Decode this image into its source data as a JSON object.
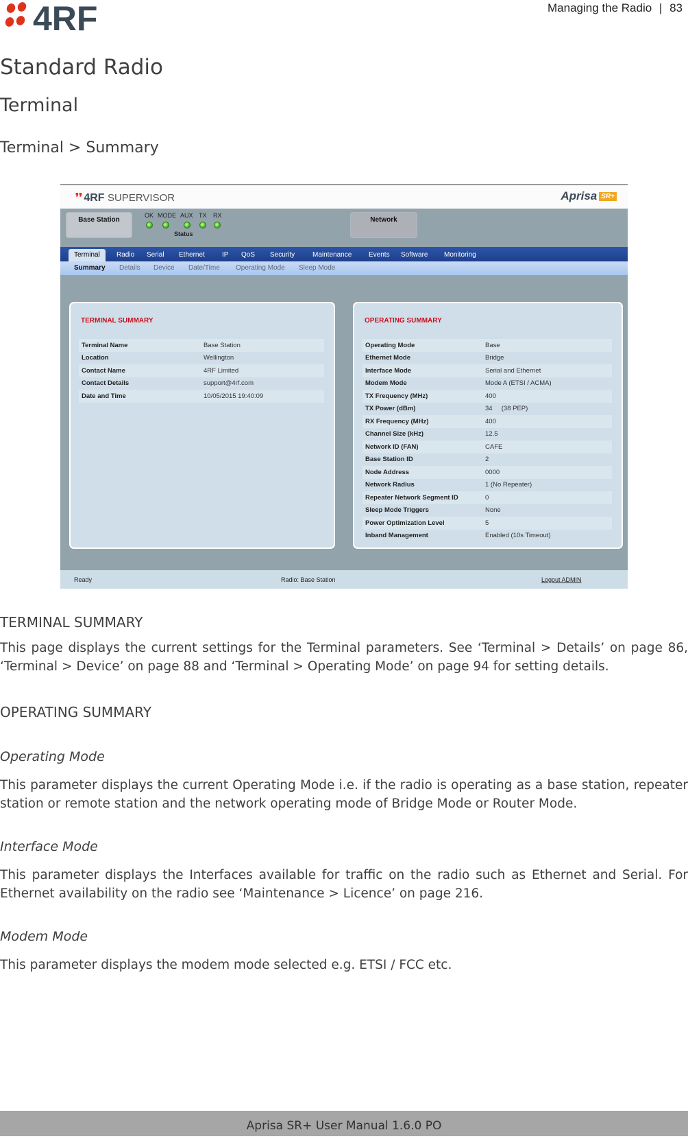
{
  "page_header": {
    "logo_text": "4RF",
    "section": "Managing the Radio",
    "separator": "|",
    "page_number": "83"
  },
  "headings": {
    "h1": "Standard Radio",
    "h2": "Terminal",
    "h3": "Terminal > Summary"
  },
  "screenshot": {
    "brand": {
      "dots": "❜❜",
      "name": "4RF",
      "product": "SUPERVISOR"
    },
    "aprisa": {
      "name": "Aprisa",
      "badge": "SR+"
    },
    "base_station_label": "Base Station",
    "network_label": "Network",
    "leds": [
      {
        "label": "OK",
        "color": "#35b015"
      },
      {
        "label": "MODE",
        "color": "#35b015"
      },
      {
        "label": "AUX",
        "color": "#35b015"
      },
      {
        "label": "TX",
        "color": "#35b015"
      },
      {
        "label": "RX",
        "color": "#35b015"
      }
    ],
    "status_label": "Status",
    "tabs": [
      "Terminal",
      "Radio",
      "Serial",
      "Ethernet",
      "IP",
      "QoS",
      "Security",
      "Maintenance",
      "Events",
      "Software",
      "Monitoring"
    ],
    "active_tab": "Terminal",
    "subtabs": [
      "Summary",
      "Details",
      "Device",
      "Date/Time",
      "Operating Mode",
      "Sleep Mode"
    ],
    "active_subtab": "Summary",
    "terminal_summary": {
      "title": "TERMINAL SUMMARY",
      "rows": [
        {
          "key": "Terminal Name",
          "value": "Base Station"
        },
        {
          "key": "Location",
          "value": "Wellington"
        },
        {
          "key": "Contact Name",
          "value": "4RF Limited"
        },
        {
          "key": "Contact Details",
          "value": "support@4rf.com"
        },
        {
          "key": "Date and Time",
          "value": "10/05/2015 19:40:09"
        }
      ]
    },
    "operating_summary": {
      "title": "OPERATING SUMMARY",
      "rows": [
        {
          "key": "Operating Mode",
          "value": "Base"
        },
        {
          "key": "Ethernet Mode",
          "value": "Bridge"
        },
        {
          "key": "Interface Mode",
          "value": "Serial and Ethernet"
        },
        {
          "key": "Modem Mode",
          "value": "Mode A (ETSI / ACMA)"
        },
        {
          "key": "TX Frequency (MHz)",
          "value": "400"
        },
        {
          "key": "TX Power (dBm)",
          "value": "34     (38 PEP)"
        },
        {
          "key": "RX Frequency (MHz)",
          "value": "400"
        },
        {
          "key": "Channel Size (kHz)",
          "value": "12.5"
        },
        {
          "key": "Network ID (FAN)",
          "value": "CAFE"
        },
        {
          "key": "Base Station ID",
          "value": "2"
        },
        {
          "key": "Node Address",
          "value": "0000"
        },
        {
          "key": "Network Radius",
          "value": "1 (No Repeater)"
        },
        {
          "key": "Repeater Network Segment ID",
          "value": "0"
        },
        {
          "key": "Sleep Mode Triggers",
          "value": "None"
        },
        {
          "key": "Power Optimization Level",
          "value": "5"
        },
        {
          "key": "Inband Management",
          "value": "Enabled (10s Timeout)"
        }
      ]
    },
    "status_bar": {
      "state": "Ready",
      "radio": "Radio: Base Station",
      "logout": "Logout ADMIN"
    }
  },
  "content": {
    "terminal_summary_heading": "TERMINAL SUMMARY",
    "terminal_summary_text": "This page displays the current settings for the Terminal parameters. See ‘Terminal > Details’ on page 86, ‘Terminal > Device’ on page 88 and ‘Terminal > Operating Mode’ on page 94 for setting details.",
    "operating_summary_heading": "OPERATING SUMMARY",
    "operating_mode_heading": "Operating Mode",
    "operating_mode_text": "This parameter displays the current Operating Mode i.e. if the radio is operating as a base station, repeater station or remote station and the network operating mode of Bridge Mode or Router Mode.",
    "interface_mode_heading": "Interface Mode",
    "interface_mode_text": "This parameter displays the Interfaces available for traffic on the radio such as Ethernet and Serial. For Ethernet availability on the radio see ‘Maintenance > Licence’ on page 216.",
    "modem_mode_heading": "Modem Mode",
    "modem_mode_text": "This parameter displays the modem mode selected e.g. ETSI / FCC etc."
  },
  "footer": {
    "text": "Aprisa SR+ User Manual 1.6.0 PO"
  }
}
